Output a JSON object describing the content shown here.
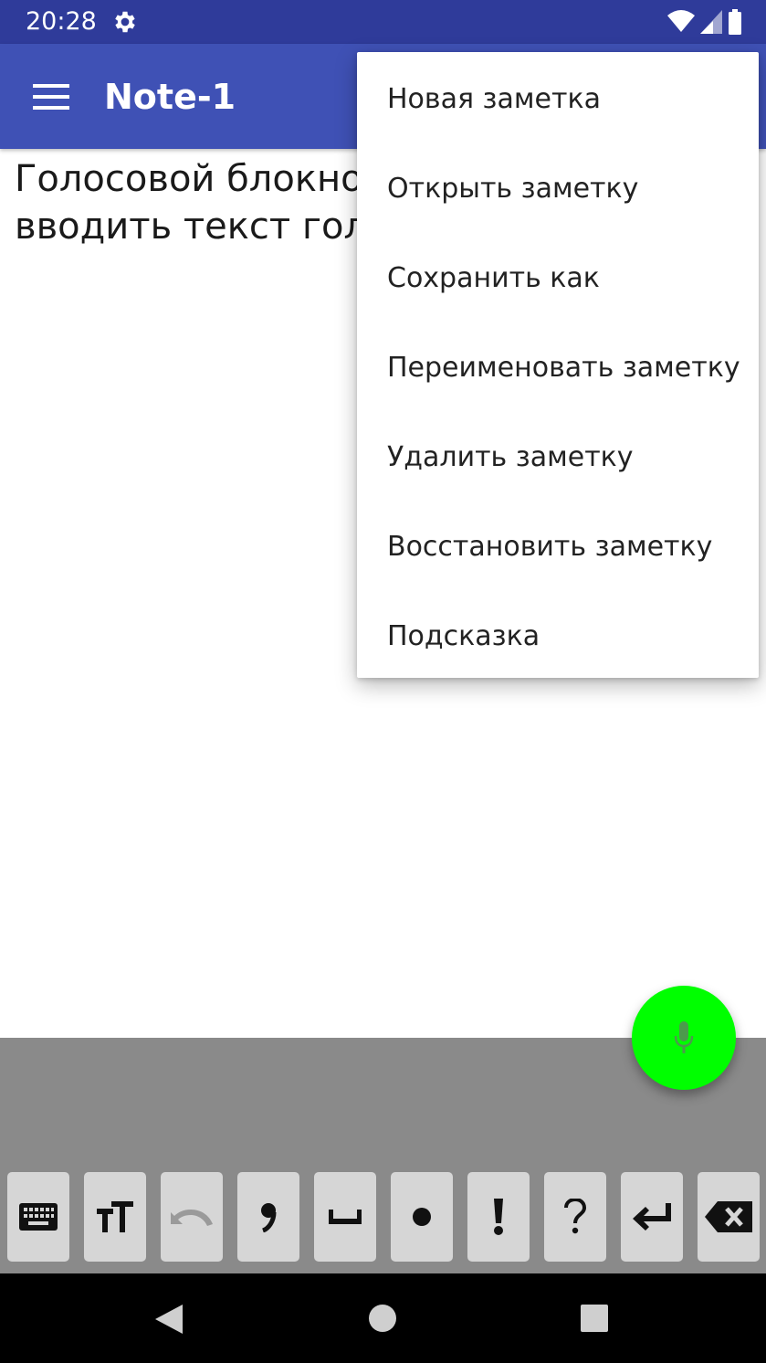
{
  "status_bar": {
    "time": "20:28"
  },
  "app_bar": {
    "title": "Note-1"
  },
  "note": {
    "text": "Голосовой блокнот позволяет вводить текст голосом"
  },
  "menu": {
    "items": [
      "Новая заметка",
      "Открыть заметку",
      "Сохранить как",
      "Переименовать заметку",
      "Удалить заметку",
      "Восстановить заметку",
      "Подсказка"
    ]
  },
  "toolbar": {
    "keys": [
      {
        "name": "keyboard-key",
        "icon": "keyboard-icon"
      },
      {
        "name": "text-size-key",
        "icon": "text-size-icon"
      },
      {
        "name": "undo-key",
        "icon": "undo-icon"
      },
      {
        "name": "comma-key",
        "glyph": ","
      },
      {
        "name": "space-key",
        "icon": "space-icon"
      },
      {
        "name": "period-key",
        "glyph": "•"
      },
      {
        "name": "exclamation-key",
        "glyph": "!"
      },
      {
        "name": "question-key",
        "glyph": "?"
      },
      {
        "name": "enter-key",
        "icon": "enter-icon"
      },
      {
        "name": "backspace-key",
        "icon": "backspace-icon"
      }
    ]
  },
  "colors": {
    "status_bar": "#2f3b9a",
    "app_bar": "#3f51b5",
    "fab": "#00ff00",
    "toolbar": "#8a8a8a",
    "key": "#d6d6d6"
  }
}
